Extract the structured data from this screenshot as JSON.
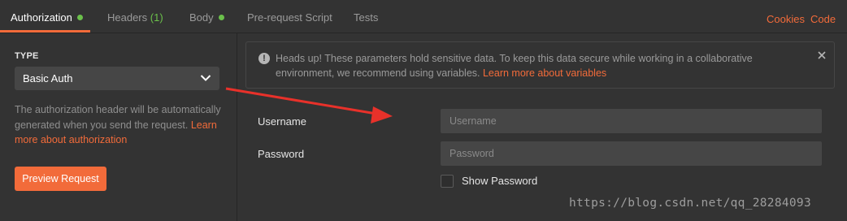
{
  "tabs": [
    {
      "label": "Authorization",
      "active": true,
      "dot": true
    },
    {
      "label": "Headers",
      "count": "(1)"
    },
    {
      "label": "Body",
      "dot": true
    },
    {
      "label": "Pre-request Script"
    },
    {
      "label": "Tests"
    }
  ],
  "top_links": {
    "cookies": "Cookies",
    "code": "Code"
  },
  "auth": {
    "type_label": "TYPE",
    "type_value": "Basic Auth",
    "description": "The authorization header will be automatically generated when you send the request. ",
    "learn_more": "Learn more about authorization",
    "preview_button": "Preview Request"
  },
  "alert": {
    "message": "Heads up! These parameters hold sensitive data. To keep this data secure while working in a collaborative environment, we recommend using variables. ",
    "link": "Learn more about variables"
  },
  "form": {
    "username_label": "Username",
    "username_placeholder": "Username",
    "username_value": "",
    "password_label": "Password",
    "password_placeholder": "Password",
    "password_value": "",
    "show_password_label": "Show Password",
    "show_password_checked": false
  },
  "watermark": "https://blog.csdn.net/qq_28284093",
  "colors": {
    "accent": "#f26b3a",
    "status_green": "#6bc04b",
    "background": "#333333",
    "annotation_arrow": "#e8312a"
  },
  "icons": [
    "chevron-down-icon",
    "info-icon",
    "close-icon"
  ]
}
